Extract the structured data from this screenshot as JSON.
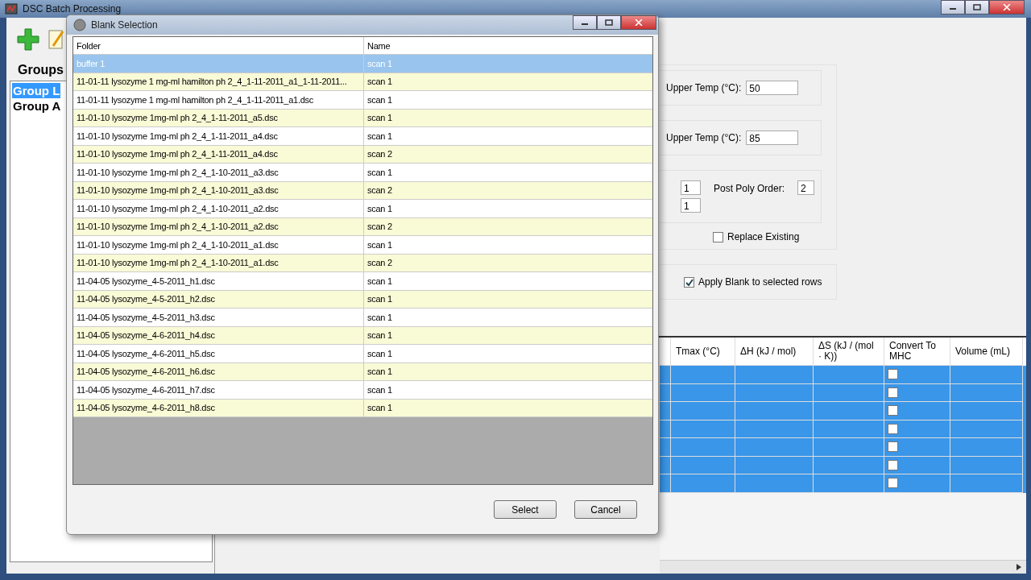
{
  "window": {
    "title": "DSC Batch Processing"
  },
  "groups": {
    "heading": "Groups",
    "items": [
      {
        "label": "Group L",
        "selected": true
      },
      {
        "label": "Group A",
        "selected": false
      }
    ]
  },
  "baseline_settings": {
    "pre_transition": {
      "label": "Upper Temp (°C):",
      "value": "50"
    },
    "post_transition": {
      "label": "Upper Temp (°C):",
      "value": "85"
    },
    "baseline_type": {
      "pre_poly_order": "1",
      "order": "1",
      "post_poly_label": "Post Poly Order:",
      "post_poly_order": "2"
    },
    "replace_existing": {
      "label": "Replace Existing",
      "checked": false
    }
  },
  "blank_settings": {
    "apply_blank": {
      "label": "Apply Blank to selected rows",
      "checked": true
    }
  },
  "results_table": {
    "columns": [
      "Tmax (°C)",
      "ΔH (kJ / mol)",
      "ΔS (kJ / (mol · K))",
      "Convert To MHC",
      "Volume (mL)"
    ],
    "rows": [
      {
        "selected": true,
        "convert_to_mhc": false
      },
      {
        "selected": true,
        "convert_to_mhc": false
      },
      {
        "selected": true,
        "convert_to_mhc": false
      },
      {
        "selected": true,
        "convert_to_mhc": false
      },
      {
        "selected": true,
        "convert_to_mhc": false
      },
      {
        "selected": true,
        "convert_to_mhc": false
      },
      {
        "selected": true,
        "convert_to_mhc": false
      }
    ]
  },
  "dialog": {
    "title": "Blank Selection",
    "columns": [
      "Folder",
      "Name"
    ],
    "rows": [
      {
        "folder": "buffer 1",
        "name": "scan 1",
        "selected": true
      },
      {
        "folder": "11-01-11 lysozyme 1 mg-ml hamilton ph 2_4_1-11-2011_a1_1-11-2011...",
        "name": "scan 1",
        "selected": false
      },
      {
        "folder": "11-01-11 lysozyme 1 mg-ml hamilton ph 2_4_1-11-2011_a1.dsc",
        "name": "scan 1",
        "selected": false
      },
      {
        "folder": "11-01-10 lysozyme 1mg-ml ph 2_4_1-11-2011_a5.dsc",
        "name": "scan 1",
        "selected": false
      },
      {
        "folder": "11-01-10 lysozyme 1mg-ml ph 2_4_1-11-2011_a4.dsc",
        "name": "scan 1",
        "selected": false
      },
      {
        "folder": "11-01-10 lysozyme 1mg-ml ph 2_4_1-11-2011_a4.dsc",
        "name": "scan 2",
        "selected": false
      },
      {
        "folder": "11-01-10 lysozyme 1mg-ml ph 2_4_1-10-2011_a3.dsc",
        "name": "scan 1",
        "selected": false
      },
      {
        "folder": "11-01-10 lysozyme 1mg-ml ph 2_4_1-10-2011_a3.dsc",
        "name": "scan 2",
        "selected": false
      },
      {
        "folder": "11-01-10 lysozyme 1mg-ml ph 2_4_1-10-2011_a2.dsc",
        "name": "scan 1",
        "selected": false
      },
      {
        "folder": "11-01-10 lysozyme 1mg-ml ph 2_4_1-10-2011_a2.dsc",
        "name": "scan 2",
        "selected": false
      },
      {
        "folder": "11-01-10 lysozyme 1mg-ml ph 2_4_1-10-2011_a1.dsc",
        "name": "scan 1",
        "selected": false
      },
      {
        "folder": "11-01-10 lysozyme 1mg-ml ph 2_4_1-10-2011_a1.dsc",
        "name": "scan 2",
        "selected": false
      },
      {
        "folder": "11-04-05 lysozyme_4-5-2011_h1.dsc",
        "name": "scan 1",
        "selected": false
      },
      {
        "folder": "11-04-05 lysozyme_4-5-2011_h2.dsc",
        "name": "scan 1",
        "selected": false
      },
      {
        "folder": "11-04-05 lysozyme_4-5-2011_h3.dsc",
        "name": "scan 1",
        "selected": false
      },
      {
        "folder": "11-04-05 lysozyme_4-6-2011_h4.dsc",
        "name": "scan 1",
        "selected": false
      },
      {
        "folder": "11-04-05 lysozyme_4-6-2011_h5.dsc",
        "name": "scan 1",
        "selected": false
      },
      {
        "folder": "11-04-05 lysozyme_4-6-2011_h6.dsc",
        "name": "scan 1",
        "selected": false
      },
      {
        "folder": "11-04-05 lysozyme_4-6-2011_h7.dsc",
        "name": "scan 1",
        "selected": false
      },
      {
        "folder": "11-04-05 lysozyme_4-6-2011_h8.dsc",
        "name": "scan 1",
        "selected": false
      }
    ],
    "buttons": [
      "Select",
      "Cancel"
    ]
  }
}
